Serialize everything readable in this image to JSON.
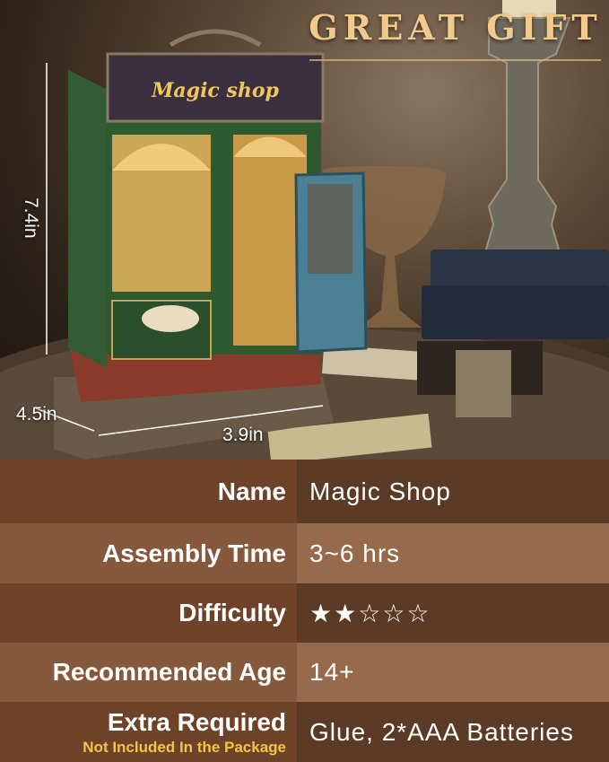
{
  "photo": {
    "headline": "GREAT GIFT",
    "shop_sign": "Magic shop",
    "dimensions": {
      "height": "7.4in",
      "depth": "4.5in",
      "width": "3.9in"
    }
  },
  "specs": [
    {
      "label": "Name",
      "value": "Magic Shop"
    },
    {
      "label": "Assembly Time",
      "value": "3~6 hrs"
    },
    {
      "label": "Difficulty",
      "value": "★★☆☆☆",
      "rating": 2,
      "max_rating": 5
    },
    {
      "label": "Recommended Age",
      "value": "14+"
    },
    {
      "label": "Extra Required",
      "sublabel": "Not Included In the Package",
      "value": "Glue, 2*AAA Batteries"
    }
  ],
  "colors": {
    "headline": "#f1c98a",
    "sublabel": "#f4c542",
    "shop_green": "#2f5a2f",
    "brick": "#8a3b2c"
  }
}
